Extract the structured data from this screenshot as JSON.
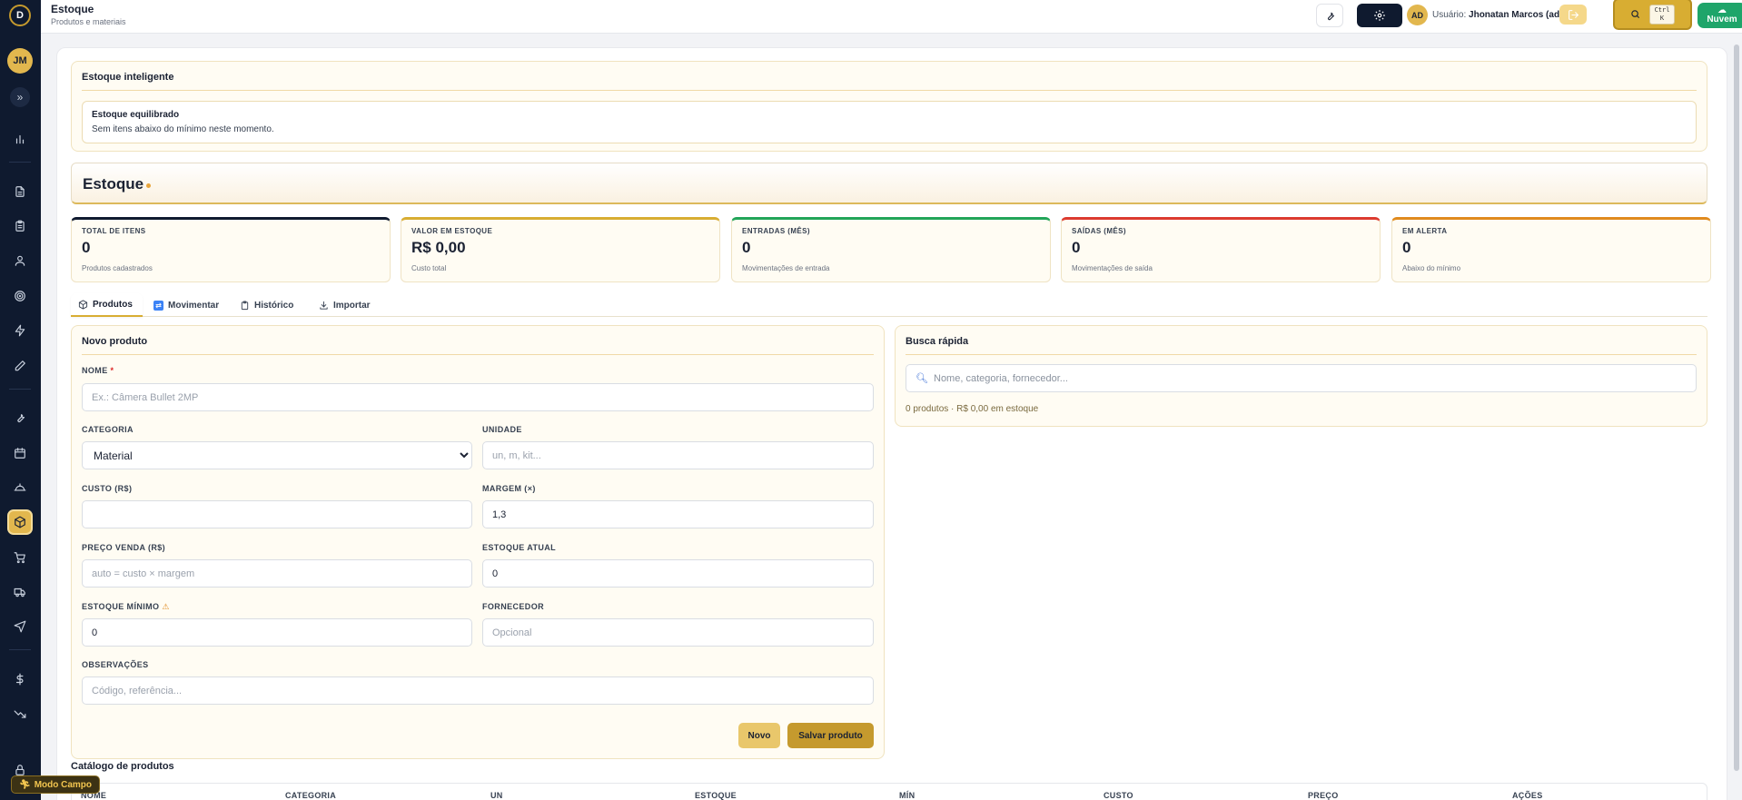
{
  "app": {
    "logo_letter": "D",
    "user_initials": "JM"
  },
  "header": {
    "title": "Estoque",
    "subtitle": "Produtos e materiais",
    "admin_initials": "AD",
    "user_prefix": "Usuário:",
    "user_name": "Jhonatan Marcos (ad...",
    "search_kbd_1": "Ctrl",
    "search_kbd_2": "K",
    "cloud_label": "Nuvem"
  },
  "sidebar": {
    "items": [
      {
        "icon": "chart-icon"
      },
      {
        "icon": "document-icon"
      },
      {
        "icon": "clipboard-icon"
      },
      {
        "icon": "user-icon"
      },
      {
        "icon": "target-icon"
      },
      {
        "icon": "lightning-icon"
      },
      {
        "icon": "pencil-icon"
      },
      {
        "icon": "wrench-icon"
      },
      {
        "icon": "calendar-icon"
      },
      {
        "icon": "hardhat-icon"
      },
      {
        "icon": "box-icon",
        "active": true
      },
      {
        "icon": "cart-icon"
      },
      {
        "icon": "truck-icon"
      },
      {
        "icon": "send-icon"
      },
      {
        "icon": "dollar-icon"
      },
      {
        "icon": "trend-down-icon"
      },
      {
        "icon": "lock-icon"
      }
    ],
    "modo_campo": "Modo Campo"
  },
  "smart_stock": {
    "title": "Estoque inteligente",
    "status_title": "Estoque equilibrado",
    "status_text": "Sem itens abaixo do mínimo neste momento."
  },
  "banner": {
    "title": "Estoque"
  },
  "stats": [
    {
      "label": "TOTAL DE ITENS",
      "value": "0",
      "sub": "Produtos cadastrados",
      "color": "#0f1a2f"
    },
    {
      "label": "VALOR EM ESTOQUE",
      "value": "R$ 0,00",
      "sub": "Custo total",
      "color": "#d8ad32"
    },
    {
      "label": "ENTRADAS (MÊS)",
      "value": "0",
      "sub": "Movimentações de entrada",
      "color": "#22a559"
    },
    {
      "label": "SAÍDAS (MÊS)",
      "value": "0",
      "sub": "Movimentações de saída",
      "color": "#dc3b2f"
    },
    {
      "label": "EM ALERTA",
      "value": "0",
      "sub": "Abaixo do mínimo",
      "color": "#e08a1e"
    }
  ],
  "tabs": [
    {
      "label": "Produtos",
      "active": true
    },
    {
      "label": "Movimentar"
    },
    {
      "label": "Histórico"
    },
    {
      "label": "Importar"
    }
  ],
  "form": {
    "title": "Novo produto",
    "nome_label": "NOME",
    "nome_required": "*",
    "nome_placeholder": "Ex.: Câmera Bullet 2MP",
    "categoria_label": "CATEGORIA",
    "categoria_value": "Material",
    "unidade_label": "UNIDADE",
    "unidade_placeholder": "un, m, kit...",
    "custo_label": "CUSTO (R$)",
    "custo_value": "",
    "margem_label": "MARGEM (×)",
    "margem_value": "1,3",
    "preco_label": "PREÇO VENDA (R$)",
    "preco_placeholder": "auto = custo × margem",
    "estoque_atual_label": "ESTOQUE ATUAL",
    "estoque_atual_value": "0",
    "estoque_minimo_label": "ESTOQUE MÍNIMO",
    "estoque_minimo_value": "0",
    "fornecedor_label": "FORNECEDOR",
    "fornecedor_placeholder": "Opcional",
    "obs_label": "OBSERVAÇÕES",
    "obs_placeholder": "Código, referência...",
    "btn_novo": "Novo",
    "btn_salvar": "Salvar produto"
  },
  "quick_search": {
    "title": "Busca rápida",
    "placeholder": "Nome, categoria, fornecedor...",
    "summary": "0 produtos · R$ 0,00 em estoque"
  },
  "catalog": {
    "title": "Catálogo de produtos",
    "columns": [
      "NOME",
      "CATEGORIA",
      "UN",
      "ESTOQUE",
      "MÍN",
      "CUSTO",
      "PREÇO",
      "AÇÕES"
    ]
  },
  "colors": {
    "accent": "#d8ad32",
    "sidebar": "#0f1a2f",
    "cloud": "#1ea56a"
  }
}
